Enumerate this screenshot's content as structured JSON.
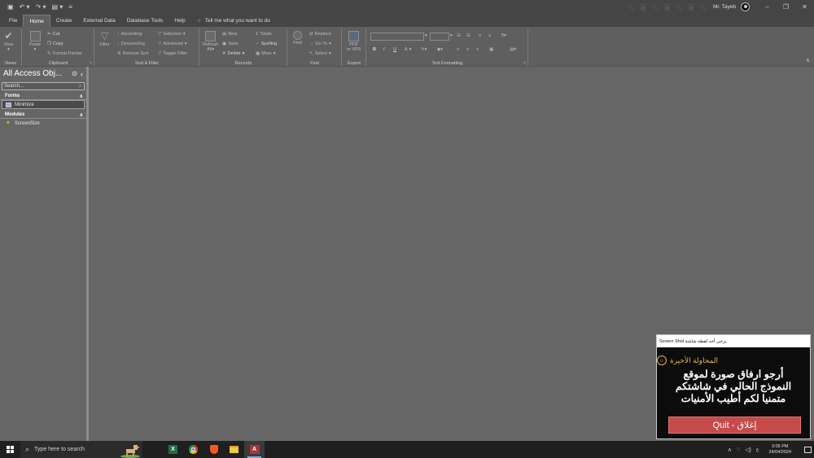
{
  "titlebar": {
    "user_name": "Mr. Tayeb",
    "qat_icons": [
      "save-icon",
      "undo-icon",
      "redo-icon",
      "view-icon",
      "customize-icon"
    ]
  },
  "tabs": [
    "File",
    "Home",
    "Create",
    "External Data",
    "Database Tools",
    "Help"
  ],
  "active_tab": "Home",
  "tell_me": "Tell me what you want to do",
  "ribbon": {
    "views": {
      "view": "View",
      "label": "Views"
    },
    "clipboard": {
      "paste": "Paste",
      "cut": "Cut",
      "copy": "Copy",
      "format_painter": "Format Painter",
      "label": "Clipboard"
    },
    "sort_filter": {
      "filter": "Filter",
      "ascending": "Ascending",
      "descending": "Descending",
      "remove_sort": "Remove Sort",
      "selection": "Selection",
      "advanced": "Advanced",
      "toggle_filter": "Toggle Filter",
      "label": "Sort & Filter"
    },
    "records": {
      "refresh": "Refresh",
      "refresh_sub": "All",
      "new": "New",
      "save": "Save",
      "delete": "Delete",
      "totals": "Totals",
      "spelling": "Spelling",
      "more": "More",
      "label": "Records"
    },
    "find": {
      "find": "Find",
      "replace": "Replace",
      "goto": "Go To",
      "select": "Select",
      "label": "Find"
    },
    "export": {
      "pdf": "PDF",
      "pdf_sub": "or XPS",
      "label": "Export"
    },
    "text_formatting": {
      "label": "Text Formatting",
      "bold": "B",
      "italic": "I",
      "underline": "U",
      "font_color": "A"
    }
  },
  "nav": {
    "title": "All Access Obj...",
    "search_placeholder": "Search...",
    "sections": [
      {
        "name": "Forms",
        "items": [
          "Minimize"
        ]
      },
      {
        "name": "Modules",
        "items": [
          "ScreenSize"
        ]
      }
    ]
  },
  "popup": {
    "title": "Screen Shot يرجى أخذ لقطة شاشة",
    "heading": "المحاولة الأخيرة",
    "message_lines": [
      "أرجو ارفاق صورة لموقع",
      "النموذج الحالي في شاشتكم",
      "متمنيا لكم أطيب الأمنيات"
    ],
    "quit_label": "Quit - إغلاق"
  },
  "taskbar": {
    "search_placeholder": "Type here to search",
    "apps": [
      "excel-icon",
      "chrome-icon",
      "brave-icon",
      "file-explorer-icon",
      "access-icon"
    ],
    "time": "3:05 PM",
    "date": "24/04/2024"
  },
  "colors": {
    "accent_access": "#a4373a",
    "quit_button": "#c64a4a",
    "popup_heading": "#e3b94a"
  }
}
